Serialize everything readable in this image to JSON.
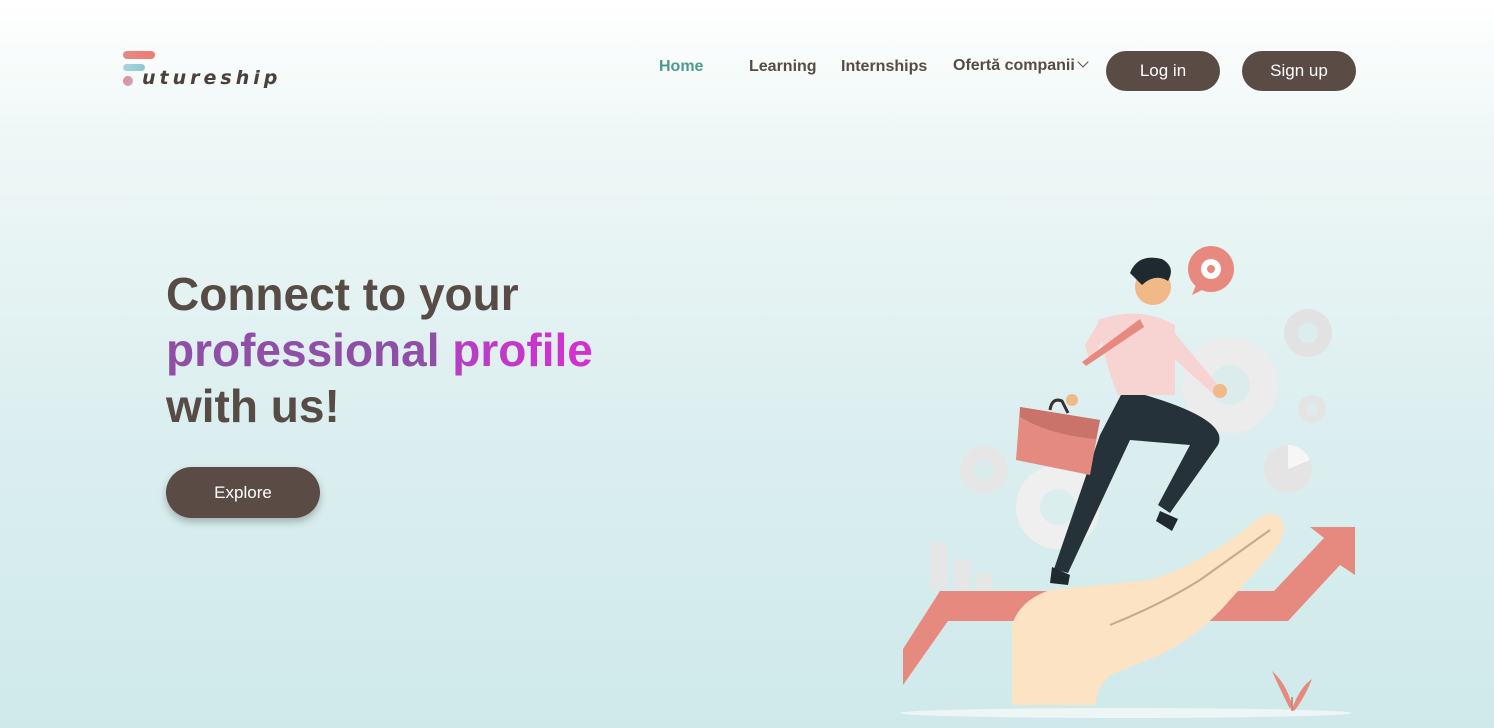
{
  "brand": {
    "logo_text": "utureship",
    "colors": {
      "accent_red": "#e58a86",
      "accent_teal": "#8cc8cf",
      "text_dark": "#574b46",
      "button": "#5b4b45",
      "active_nav": "#4e9a93"
    }
  },
  "nav": {
    "items": [
      {
        "label": "Home",
        "active": true
      },
      {
        "label": "Learning",
        "active": false
      },
      {
        "label": "Internships",
        "active": false
      },
      {
        "label": "Ofertă companii",
        "active": false,
        "dropdown": true
      }
    ],
    "login_label": "Log in",
    "signup_label": "Sign up"
  },
  "hero": {
    "line1": "Connect to your",
    "highlight1": "professional",
    "highlight2": "profile",
    "line3": "with us!",
    "cta_label": "Explore"
  },
  "illustration": {
    "icons": [
      "gear-icon",
      "briefcase-icon",
      "pie-chart-icon",
      "bar-chart-icon",
      "arrow-up-icon",
      "hand-icon"
    ]
  }
}
